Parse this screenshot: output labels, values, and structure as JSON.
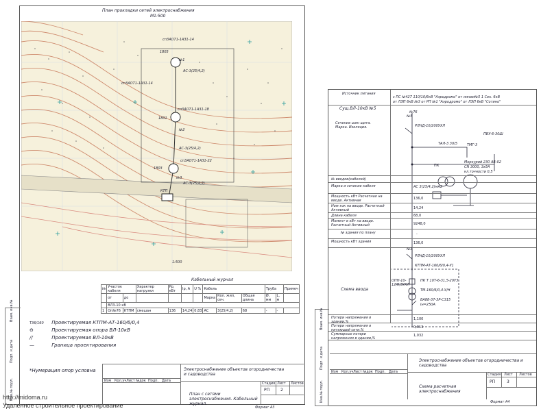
{
  "sheet1": {
    "plan_title": "План прокладки сетей электроснабжения",
    "plan_scale": "М1:500",
    "map_labels": {
      "cable_1": "сп3АО71-1АЗ1-14",
      "cable_2": "сп3АО71-1А31-18",
      "cable_3": "сп3АО71-1А31-22",
      "cable_4": "сп3АО71-1А31-14",
      "pole_1": "№1",
      "pole_2": "№2",
      "pole_3": "№3",
      "elev_1": "1805",
      "elev_2": "1801",
      "elev_3": "1803",
      "wire_1": "АС-3(25/4,2)",
      "wire_2": "АС-3(25/4,2)",
      "wire_3": "АС-3(25/4,2)",
      "ktp": "КТП",
      "scale_mark": "1:500"
    },
    "cable_journal": {
      "title": "Кабельный журнал",
      "headers": [
        "№",
        "Участок кабеля",
        "Характер нагрузки",
        "Рр, кВт",
        "Iр, А",
        "U %",
        "Кабель",
        "Труба",
        "Примеч"
      ],
      "subheaders": [
        "от",
        "до",
        "Марка",
        "Кол. жил, сеч.",
        "Общая длина",
        "Ø, мм",
        "L, м"
      ],
      "row_group": "ВЛ3-10 кВ",
      "rows": [
        [
          "1",
          "Оп№76",
          "КТПМ",
          "смешан",
          "136",
          "14,24",
          "0,83",
          "АС",
          "3(25/4,2)",
          "68",
          "-",
          "-"
        ]
      ]
    },
    "legend": [
      {
        "symbol": "Т36/160",
        "text": "Проектируемая КТПМ-АТ-160/6/0,4"
      },
      {
        "symbol": "⊖",
        "text": "Проектируемая опора ВЛ-10кВ"
      },
      {
        "symbol": "//",
        "text": "Проектируемая ВЛ-10кВ"
      },
      {
        "symbol": "—",
        "text": "Граница проектирования"
      }
    ],
    "note": "*Нумерация опор условна",
    "stamp": {
      "project": "Электроснабжение объектов огородничества и садоводства",
      "sheet_title": "План с сетями электроснабжения. Кабельный журнал.",
      "stage_label": "Стадия",
      "sheet_label": "Лист",
      "sheets_label": "Листов",
      "stage": "РП",
      "sheet": "2",
      "sheets": "",
      "cols": [
        "Изм",
        "Кол.уч",
        "Лист",
        "№док",
        "Подп.",
        "Дата"
      ],
      "format": "Формат А3"
    },
    "side_labels": [
      "Взам. инв.№",
      "Подп. и дата",
      "Инв.№ подл."
    ]
  },
  "sheet2": {
    "header_left": "Источник питания",
    "supply_text_1": "с ПС №427 110/10/6кВ \"Аэродромо\" от линии№5 1 Сек. 6кВ",
    "supply_text_2": "от ЛЭП 6кВ №3 от РП №1 \"Аэродромо\" от ЛЭП 6кВ \"Сотино\"",
    "line_label": "Сущ.ВЛ-10кВ №5",
    "pole_top": "№76",
    "section_label": "Сечение шин щита. Марка. Изоляция.",
    "pole_no": "№5",
    "rlnd_1": "РЛНД-10/200УХЛ",
    "pvu": "ПВУ-6-30Ш",
    "tal": "ТАЛ-3 30/5",
    "tmg": "ТМГ-3",
    "meter": "Меркурий 230 АR-02",
    "meter_spec": "СN 3000, 3х5А",
    "accuracy": "кл.точности 0,5",
    "pk": "ПК",
    "rows_top": [
      {
        "label": "№ вводов(кабелей)",
        "value": ""
      },
      {
        "label": "Марка и сечение кабеля",
        "value": "АС 3(25/4,2)мм2"
      },
      {
        "label": "Мощность кВт Расчетная на вводе. Активная",
        "value": "136,0"
      },
      {
        "label": "Ном.ток на вводе. Расчетный Активный",
        "value": "14,24"
      },
      {
        "label": "Длина кабеля",
        "value": "68,0"
      },
      {
        "label": "Момент в кВт на вводе. Расчетный Активный",
        "value": "9248,0"
      },
      {
        "label": "№ здания по плану",
        "value": "-"
      },
      {
        "label": "Мощность кВт здания",
        "value": "136,0"
      }
    ],
    "pole_no_2": "№3",
    "rlnd_2": "РЛНД-10/200УХЛ",
    "ktpm": "КТПМ-АТ-160/6/0,4-У1",
    "pk_fuse": "ПК Т 10Т-6-31,5-20У3",
    "tm": "ТМ-160/6/0,4-У/Н",
    "breaker": "ВА88-37-3Р-С315",
    "breaker_sub": "Iн=250А",
    "opn": "ОПН-10-12/0,5УХЛ",
    "scheme_label": "Схема ввода",
    "rows_bottom": [
      {
        "label": "Потери напряжения в здании,%",
        "value": "1,100"
      },
      {
        "label": "Потери напряжения в питающей сети,%",
        "value": "0,813"
      },
      {
        "label": "Суммарные потери напряжения в здании,%",
        "value": "1,032"
      }
    ],
    "stamp": {
      "project": "Электроснабжение объектов огородничества и садоводства",
      "sheet_title": "Схема расчетная электроснабжения",
      "stage_label": "Стадия",
      "sheet_label": "Лист",
      "sheets_label": "Листов",
      "stage": "РП",
      "sheet": "3",
      "sheets": "",
      "cols": [
        "Изм",
        "Кол.уч",
        "Лист",
        "№док",
        "Подп.",
        "Дата"
      ],
      "format": "Формат А4"
    },
    "side_labels": [
      "Взам. инв.№",
      "Подп. и дата",
      "Инв.№ подл."
    ]
  },
  "watermark": {
    "url": "http://midoma.ru",
    "caption": "Удаленное строительное проектирование"
  }
}
